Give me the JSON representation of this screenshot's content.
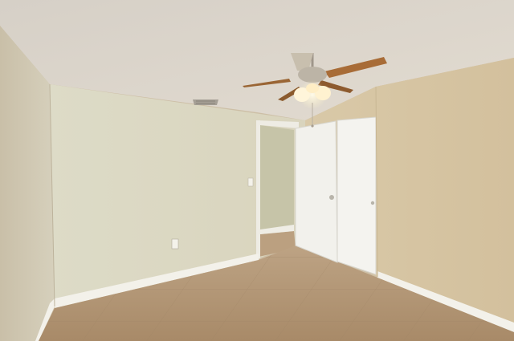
{
  "scene": {
    "description_free": true,
    "colors": {
      "ceiling": "#d9d2c8",
      "left_wall": "#cfc7b4",
      "back_wall": "#dcd8c3",
      "right_wall": "#d8c7a6",
      "hall_wall": "#c8c7ad",
      "floor": "#b79c7c",
      "baseboard": "#f3f1ea",
      "door": "#f2f1ec",
      "fan_blade": "#a46a35",
      "fan_housing": "#b9b1a3",
      "light": "#fff6d8"
    },
    "icons": [
      "ceiling-fan-icon",
      "air-vent-icon",
      "light-switch-icon",
      "power-outlet-icon",
      "door-knob-icon"
    ]
  }
}
